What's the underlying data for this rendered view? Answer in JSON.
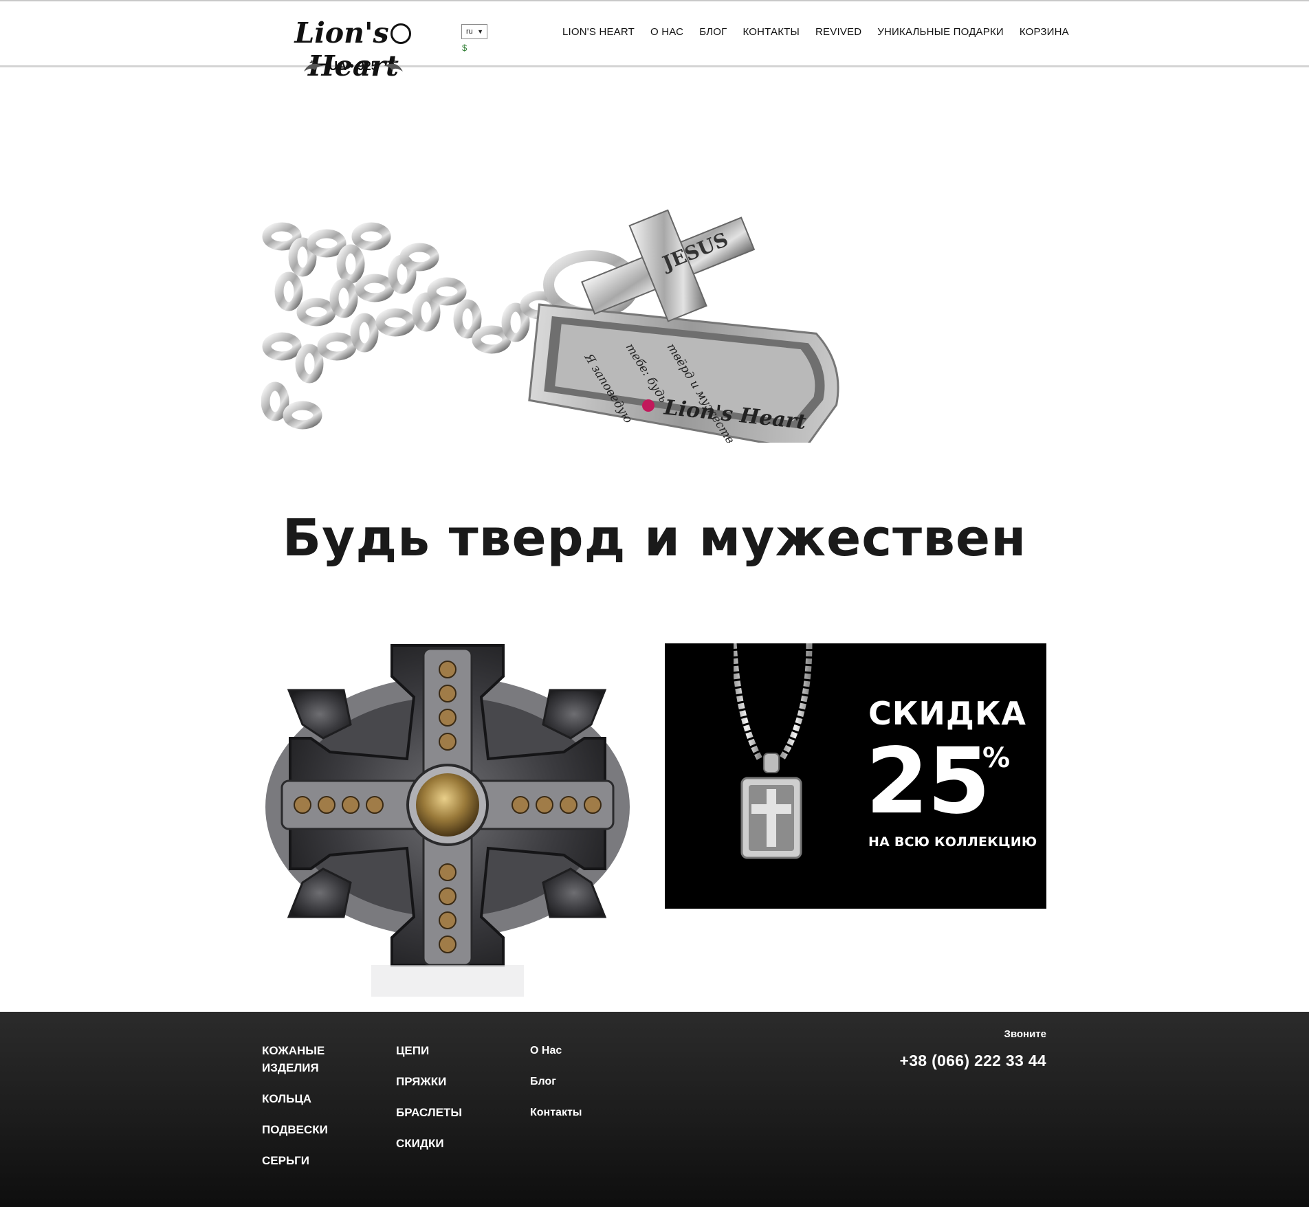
{
  "header": {
    "logo": {
      "brand_left": "Lion's",
      "brand_right": "Heart",
      "sub": "UA • 925"
    },
    "language": {
      "selected": "ru"
    },
    "currency": "$",
    "nav": [
      {
        "label": "LION'S HEART"
      },
      {
        "label": "О НАС"
      },
      {
        "label": "БЛОГ"
      },
      {
        "label": "КОНТАКТЫ"
      },
      {
        "label": "REVIVED"
      },
      {
        "label": "УНИКАЛЬНЫЕ ПОДАРКИ"
      },
      {
        "label": "КОРЗИНА"
      }
    ]
  },
  "hero": {
    "image_icon": "silver-chain-pendant-image",
    "engraving": {
      "cross": "JESUS",
      "tag_lines": [
        "Я заповедую",
        "тебе: будь",
        "твёрд и мужествен"
      ],
      "brand": "Lion's Heart"
    }
  },
  "slogan": "Будь тверд и мужествен",
  "ring": {
    "image_icon": "jerusalem-cross-ring-image"
  },
  "promo": {
    "title": "СКИДКА",
    "number": "25",
    "percent": "%",
    "subtitle": "НА ВСЮ КОЛЛЕКЦИЮ",
    "background": "#000000"
  },
  "footer": {
    "col1": [
      {
        "label": "КОЖАНЫЕ ИЗДЕЛИЯ"
      },
      {
        "label": "КОЛЬЦА"
      },
      {
        "label": "ПОДВЕСКИ"
      },
      {
        "label": "СЕРЬГИ"
      }
    ],
    "col2": [
      {
        "label": "ЦЕПИ"
      },
      {
        "label": "ПРЯЖКИ"
      },
      {
        "label": "БРАСЛЕТЫ"
      },
      {
        "label": "СКИДКИ"
      }
    ],
    "col3": [
      {
        "label": "О Нас"
      },
      {
        "label": "Блог"
      },
      {
        "label": "Контакты"
      }
    ],
    "call_label": "Звоните",
    "phone": "+38 (066) 222 33 44"
  }
}
